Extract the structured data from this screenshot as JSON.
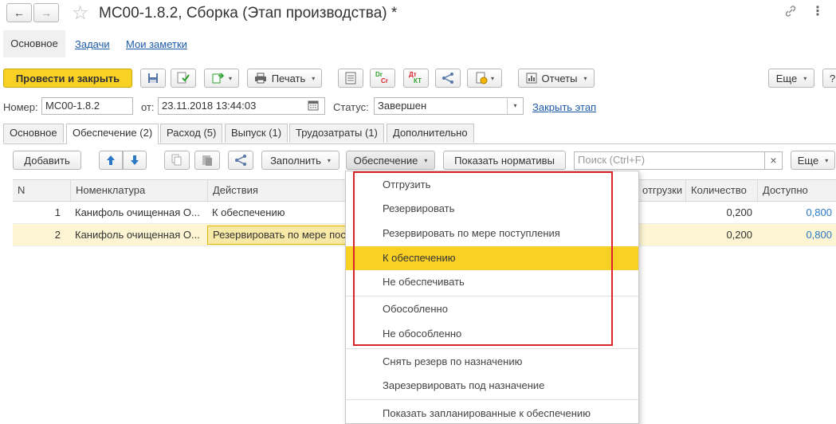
{
  "window": {
    "title": "МС00-1.8.2, Сборка (Этап производства) *"
  },
  "nav": {
    "back": "←",
    "forward": "→",
    "star": "☆",
    "link_icon": "🔗",
    "more": "⋮"
  },
  "top_tabs": {
    "main": "Основное",
    "tasks": "Задачи",
    "notes": "Мои заметки"
  },
  "toolbar": {
    "post_close": "Провести и закрыть",
    "print": "Печать",
    "reports": "Отчеты",
    "more": "Еще",
    "help": "?",
    "dt_kt_top": "Dr",
    "dt_kt_bottom": "Cr",
    "dt_kt2_top": "Дт",
    "dt_kt2_bottom": "КТ"
  },
  "header_fields": {
    "number_label": "Номер:",
    "number_value": "МС00-1.8.2",
    "date_label": "от:",
    "date_value": "23.11.2018 13:44:03",
    "status_label": "Статус:",
    "status_value": "Завершен",
    "close_stage_link": "Закрыть этап"
  },
  "form_tabs": [
    "Основное",
    "Обеспечение (2)",
    "Расход (5)",
    "Выпуск (1)",
    "Трудозатраты (1)",
    "Дополнительно"
  ],
  "grid_toolbar": {
    "add": "Добавить",
    "fill": "Заполнить",
    "provision": "Обеспечение",
    "show_norms": "Показать нормативы",
    "search_placeholder": "Поиск (Ctrl+F)",
    "clear": "×",
    "more": "Еще"
  },
  "table": {
    "columns": [
      "N",
      "Номенклатура",
      "Действия",
      "отгрузки",
      "Количество",
      "Доступно"
    ],
    "rows": [
      {
        "n": "1",
        "item": "Канифоль очищенная О...",
        "action": "К обеспечению",
        "qty": "0,200",
        "avail": "0,800"
      },
      {
        "n": "2",
        "item": "Канифоль очищенная О...",
        "action": "Резервировать по мере пос",
        "qty": "0,200",
        "avail": "0,800"
      }
    ]
  },
  "dropdown": {
    "items_group1": [
      "Отгрузить",
      "Резервировать",
      "Резервировать по мере поступления",
      "К обеспечению",
      "Не обеспечивать"
    ],
    "items_group2": [
      "Обособленно",
      "Не обособленно"
    ],
    "items_group3": [
      "Снять резерв по назначению",
      "Зарезервировать под назначение"
    ],
    "items_group4": [
      "Показать запланированные к обеспечению"
    ],
    "selected": "К обеспечению"
  },
  "colors": {
    "accent_yellow": "#f9d125",
    "link_blue": "#1e5aa8",
    "highlight_red": "#d9232d",
    "selected_row": "#fdf5d3"
  }
}
